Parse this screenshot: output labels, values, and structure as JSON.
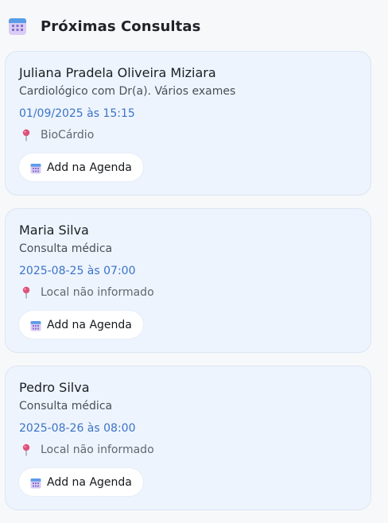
{
  "header": {
    "title": "Próximas Consultas",
    "icon": "calendar-icon"
  },
  "appointments": [
    {
      "name": "Juliana Pradela Oliveira Miziara",
      "description": "Cardiológico com Dr(a). Vários exames",
      "datetime": "01/09/2025 às 15:15",
      "location": "BioCárdio",
      "button_label": "Add na Agenda"
    },
    {
      "name": "Maria Silva",
      "description": "Consulta médica",
      "datetime": "2025-08-25 às 07:00",
      "location": "Local não informado",
      "button_label": "Add na Agenda"
    },
    {
      "name": "Pedro Silva",
      "description": "Consulta médica",
      "datetime": "2025-08-26 às 08:00",
      "location": "Local não informado",
      "button_label": "Add na Agenda"
    }
  ],
  "colors": {
    "card_bg": "#eef4fd",
    "card_border": "#dbe5f3",
    "date_text": "#3a73c8",
    "pin": "#e0507a"
  },
  "icons": {
    "location": "pin-icon",
    "button": "calendar-icon"
  }
}
